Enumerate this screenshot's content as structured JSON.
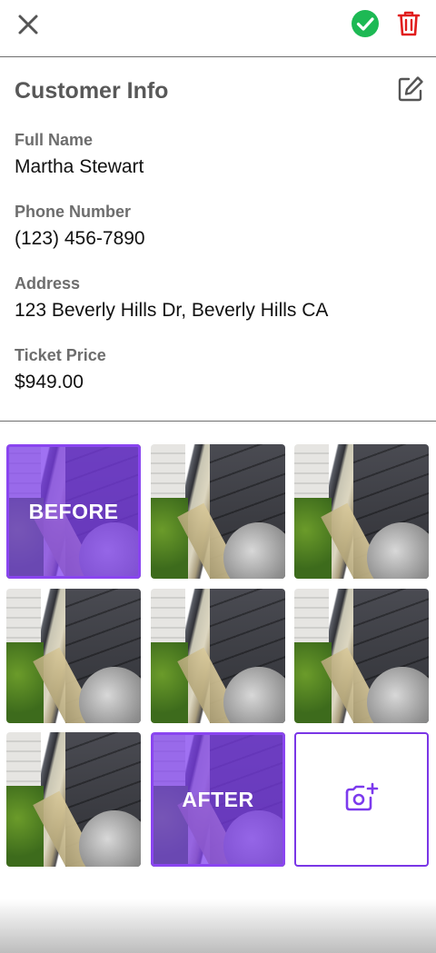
{
  "toolbar": {
    "close_icon": "close-icon",
    "confirm_icon": "check-circle-icon",
    "delete_icon": "trash-icon",
    "confirm_color": "#1db954",
    "delete_color": "#e11d1d"
  },
  "customer": {
    "title": "Customer Info",
    "edit_icon": "edit-icon",
    "fields": [
      {
        "label": "Full Name",
        "value": "Martha Stewart"
      },
      {
        "label": "Phone Number",
        "value": "(123) 456-7890"
      },
      {
        "label": "Address",
        "value": "123 Beverly Hills Dr, Beverly Hills CA"
      },
      {
        "label": "Ticket Price",
        "value": "$949.00"
      }
    ]
  },
  "photos": {
    "before_label": "BEFORE",
    "after_label": "AFTER",
    "add_icon": "add-photo-icon",
    "accent_color": "#7c3aed"
  }
}
